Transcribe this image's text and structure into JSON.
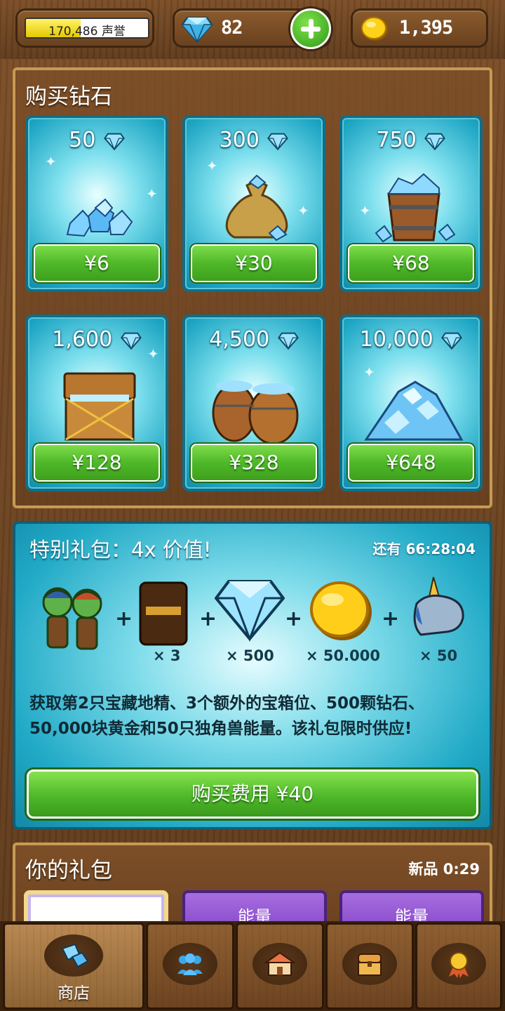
{
  "topbar": {
    "reputation_text": "170,486 声誉",
    "reputation_progress": 0.45,
    "gems": "82",
    "gold": "1,395",
    "icons": {
      "gems": "diamond-icon",
      "add": "plus-icon",
      "gold": "gold-coin-icon"
    }
  },
  "shop": {
    "title": "购买钻石",
    "cards": [
      {
        "amount": "50",
        "price": "¥6",
        "art": "small-gem-pile"
      },
      {
        "amount": "300",
        "price": "¥30",
        "art": "gem-sack"
      },
      {
        "amount": "750",
        "price": "¥68",
        "art": "gem-bucket"
      },
      {
        "amount": "1,600",
        "price": "¥128",
        "art": "gem-chest"
      },
      {
        "amount": "4,500",
        "price": "¥328",
        "art": "gem-barrels"
      },
      {
        "amount": "10,000",
        "price": "¥648",
        "art": "gem-mountain"
      }
    ]
  },
  "special": {
    "title": "特别礼包：4x 价值!",
    "timer": "还有 66:28:04",
    "items": [
      {
        "icon": "goblin-pair-icon",
        "qty": ""
      },
      {
        "icon": "treasure-slot-card-icon",
        "qty": "× 3"
      },
      {
        "icon": "diamond-icon",
        "qty": "× 500"
      },
      {
        "icon": "gold-coin-icon",
        "qty": "× 50.000"
      },
      {
        "icon": "unicorn-icon",
        "qty": "× 50"
      }
    ],
    "description": "获取第2只宝藏地精、3个额外的宝箱位、500颗钻石、50,000块黄金和50只独角兽能量。该礼包限时供应!",
    "buy_label": "购买费用 ¥40"
  },
  "packs": {
    "title": "你的礼包",
    "new_timer": "新品 0:29",
    "tabs": [
      "",
      "能量",
      "能量"
    ]
  },
  "nav": {
    "items": [
      {
        "label": "商店",
        "icon": "gems-icon",
        "active": true
      },
      {
        "label": "",
        "icon": "friends-icon",
        "active": false
      },
      {
        "label": "",
        "icon": "village-icon",
        "active": false
      },
      {
        "label": "",
        "icon": "treasure-chest-icon",
        "active": false
      },
      {
        "label": "",
        "icon": "achievement-medal-icon",
        "active": false
      }
    ]
  },
  "colors": {
    "card_teal": "#1ea6c4",
    "button_green": "#4fb829",
    "wood": "#6b4321",
    "pack_purple": "#7a3fc0"
  }
}
